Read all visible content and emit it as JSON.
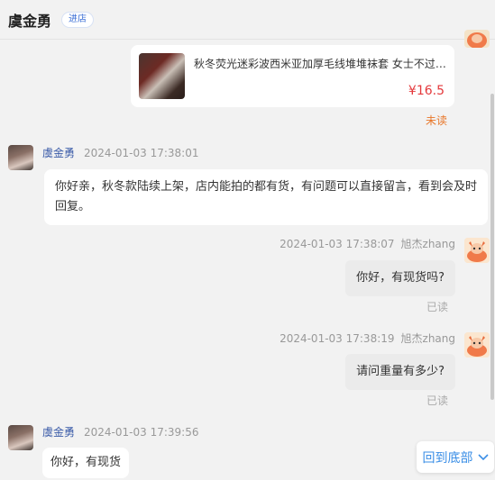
{
  "header": {
    "shop_name": "虞金勇",
    "badge": "进店"
  },
  "product_card": {
    "title": "秋冬荧光迷彩波西米亚加厚毛线堆堆袜套 女士不过膝保暖腿套",
    "price": "¥16.5",
    "status": "未读"
  },
  "messages": [
    {
      "sender": "虞金勇",
      "time": "2024-01-03 17:38:01",
      "text": "你好亲，秋冬款陆续上架，店内能拍的都有货，有问题可以直接留言，看到会及时回复。"
    },
    {
      "sender": "旭杰zhang",
      "time": "2024-01-03 17:38:07",
      "text": "你好，有现货吗?",
      "status": "已读"
    },
    {
      "sender": "旭杰zhang",
      "time": "2024-01-03 17:38:19",
      "text": "请问重量有多少?",
      "status": "已读"
    },
    {
      "sender": "虞金勇",
      "time": "2024-01-03 17:39:56",
      "text": "你好，有现货"
    }
  ],
  "scroll_bottom_label": "回到底部",
  "colors": {
    "accent": "#3a8ee6",
    "price": "#e4393c",
    "unread": "#e8772a",
    "shop_name_link": "#3a5ba8"
  }
}
